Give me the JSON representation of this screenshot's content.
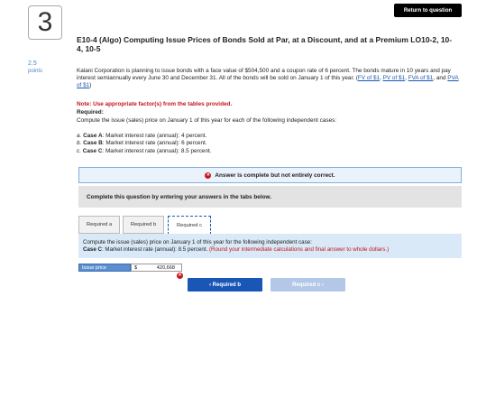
{
  "question": {
    "number": "3",
    "points_value": "2.5",
    "points_label": "points"
  },
  "header": {
    "return_label": "Return to question"
  },
  "title": "E10-4 (Algo) Computing Issue Prices of Bonds Sold at Par, at a Discount, and at a Premium LO10-2, 10-4, 10-5",
  "intro": {
    "text": "Kalani Corporation is planning to issue bonds with a face value of $504,500 and a coupon rate of 6 percent. The bonds mature in 10 years and pay interest semiannually every June 30 and December 31. All of the bonds will be sold on January 1 of this year. (",
    "links": [
      "FV of $1",
      "PV of $1",
      "FVA of $1",
      "PVA of $1"
    ],
    "sep1": ", ",
    "sep2": ", ",
    "sep3": ", and ",
    "end": ")"
  },
  "note": "Note: Use appropriate factor(s) from the tables provided.",
  "required_label": "Required:",
  "compute_text": "Compute the issue (sales) price on January 1 of this year for each of the following independent cases:",
  "cases": [
    {
      "letter": "a.",
      "name": "Case A",
      "text": ": Market interest rate (annual): 4 percent."
    },
    {
      "letter": "b.",
      "name": "Case B",
      "text": ": Market interest rate (annual): 6 percent."
    },
    {
      "letter": "c.",
      "name": "Case C",
      "text": ": Market interest rate (annual): 8.5 percent."
    }
  ],
  "answer_status": "Answer is complete but not entirely correct.",
  "tabs_instruction": "Complete this question by entering your answers in the tabs below.",
  "tabs": [
    "Required a",
    "Required b",
    "Required c"
  ],
  "panel": {
    "line1": "Compute the issue (sales) price on January 1 of this year for the following independent case:",
    "case_name": "Case C",
    "case_text": ": Market interest rate (annual): 8.5 percent.",
    "hint": "(Round your intermediate calculations and final answer to whole dollars.)"
  },
  "answer_row": {
    "label": "Issue price",
    "currency": "$",
    "value": "420,668"
  },
  "nav": {
    "prev": "‹  Required b",
    "next": "Required c  ›"
  },
  "colors": {
    "accent": "#1a56b5",
    "error": "#c4161c",
    "panel": "#d9e9f7"
  }
}
